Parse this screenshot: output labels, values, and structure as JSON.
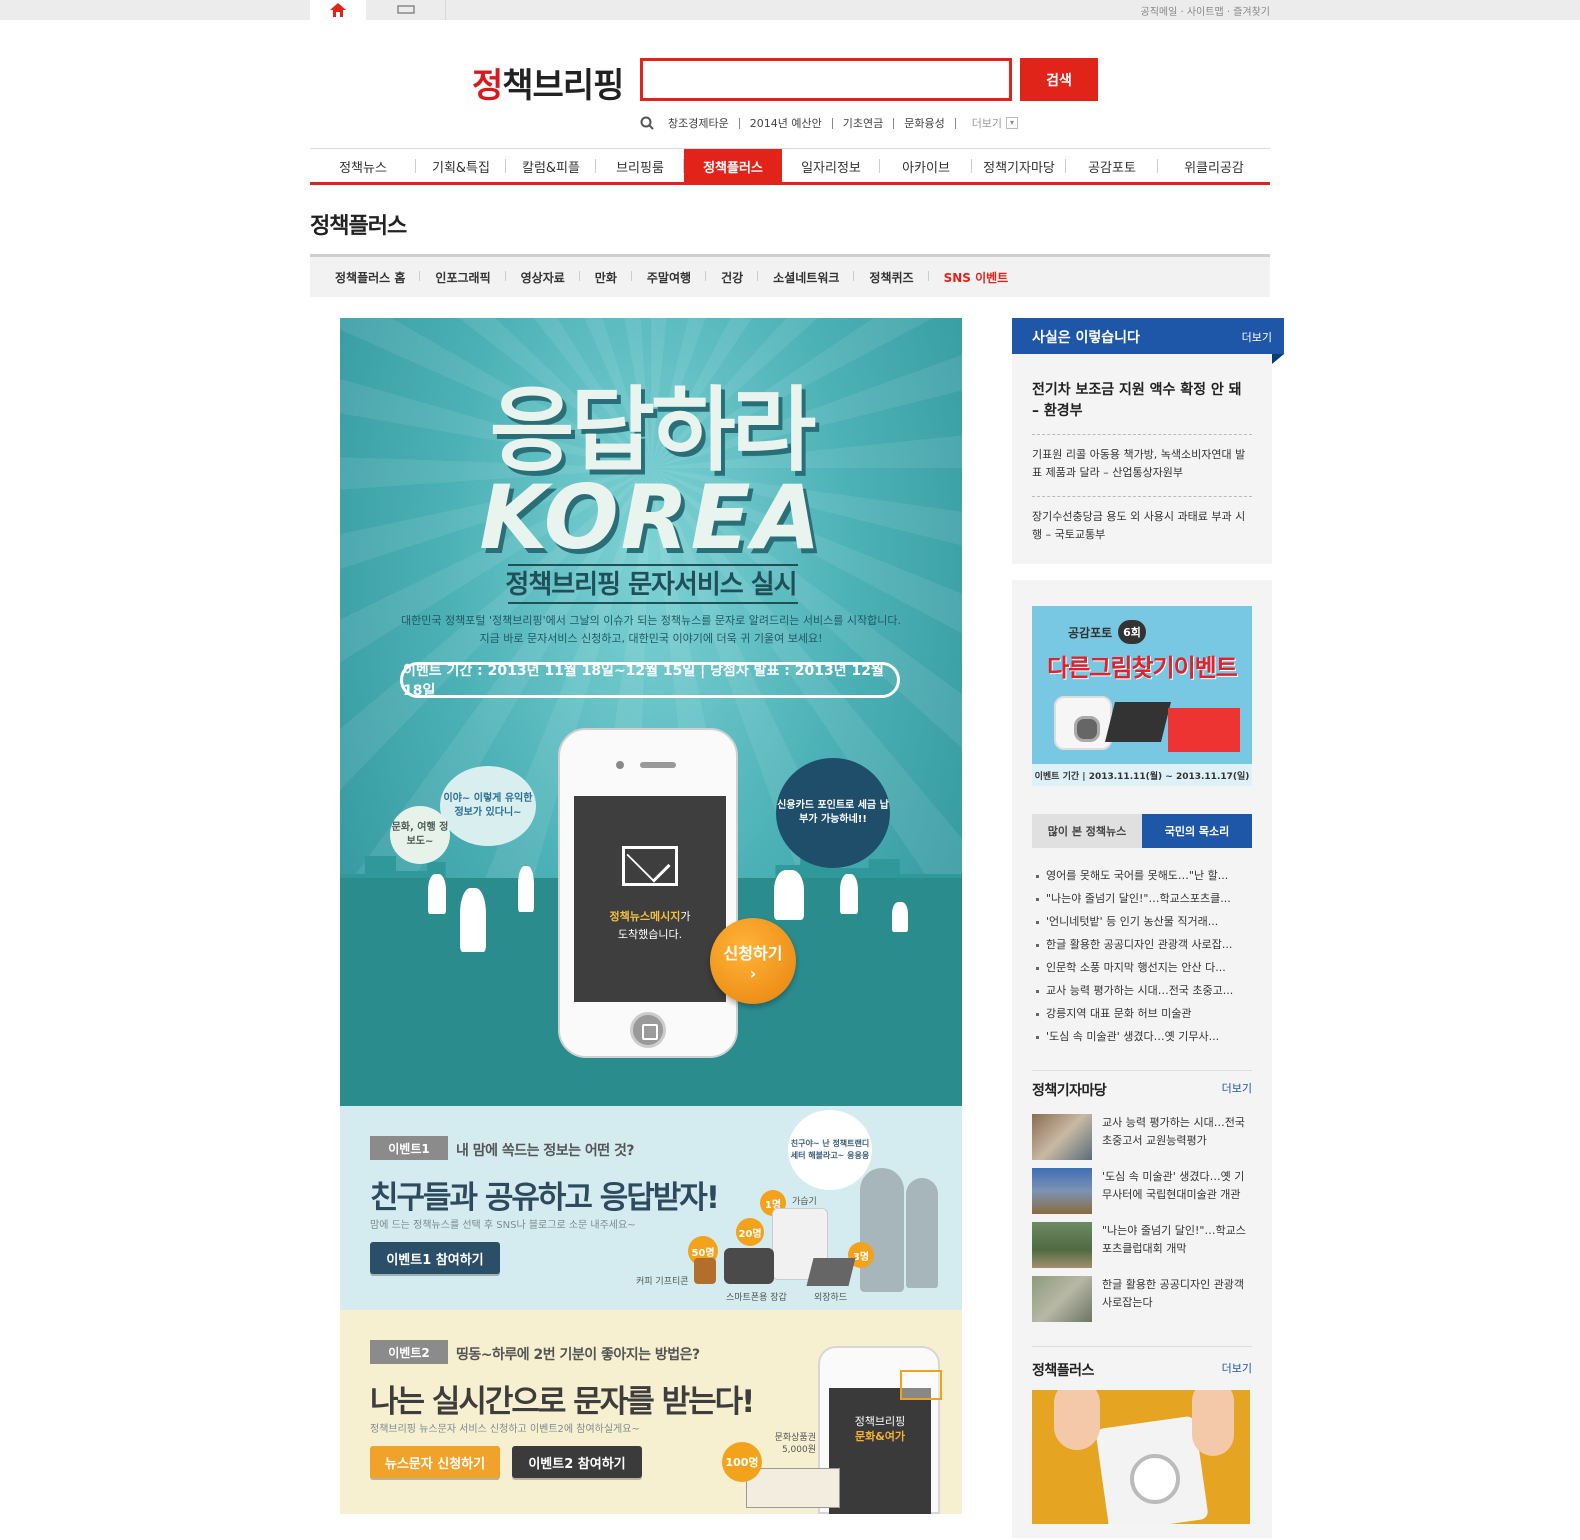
{
  "topbar": {
    "links": "공직메일 · 사이트맵 · 즐겨찾기"
  },
  "header": {
    "logo": "정책브리핑",
    "search_placeholder": "",
    "search_button": "검색",
    "keywords": [
      "창조경제타운",
      "2014년 예산안",
      "기초연금",
      "문화융성"
    ],
    "more": "더보기"
  },
  "gnb": [
    "정책뉴스",
    "기획&특집",
    "칼럼&피플",
    "브리핑룸",
    "정책플러스",
    "일자리정보",
    "아카이브",
    "정책기자마당",
    "공감포토",
    "위클리공감"
  ],
  "gnb_active": 4,
  "page_title": "정책플러스",
  "subnav": [
    "정책플러스 홈",
    "인포그래픽",
    "영상자료",
    "만화",
    "주말여행",
    "건강",
    "소셜네트워크",
    "정책퀴즈",
    "SNS 이벤트"
  ],
  "banner": {
    "title1": "응답하라",
    "title2": "KOREA",
    "subtitle": "정책브리핑 문자서비스 실시",
    "desc1": "대한민국 정책포털 '정책브리핑'에서 그날의 이슈가 되는 정책뉴스를 문자로 알려드리는 서비스를 시작합니다.",
    "desc2": "지금 바로 문자서비스 신청하고, 대한민국 이야기에 더욱 귀 기울여 보세요!",
    "period": "이벤트 기간 : 2013년 11월 18일~12월 15일 | 당첨자 발표 : 2013년 12월 18일",
    "bubble1": "이야~ 이렇게 유익한 정보가 있다니~",
    "bubble2": "문화, 여행 정보도~",
    "bubble3": "신용카드 포인트로 세금 납부가 가능하네!!",
    "phone_msg_highlight": "정책뉴스메시지",
    "phone_msg_rest1": "가",
    "phone_msg_rest2": "도착했습니다.",
    "apply": "신청하기",
    "apply_arrow": "›",
    "ev1": {
      "tag": "이벤트1",
      "question": "내 맘에 쏙드는 정보는 어떤 것?",
      "headline": "친구들과 공유하고 응답받자!",
      "desc": "맘에 드는 정책뉴스를 선택 후 SNS나 블로그로 소문 내주세요~",
      "button": "이벤트1 참여하기",
      "bubble": "친구야~ 난 정책트랜디세터 해볼라고~ 응응응",
      "prizes": [
        {
          "count": "1명",
          "label": "가습기"
        },
        {
          "count": "20명",
          "label": "스마트폰용 장갑"
        },
        {
          "count": "50명",
          "label": "커피 기프티콘"
        },
        {
          "count": "3명",
          "label": "외장하드"
        }
      ]
    },
    "ev2": {
      "tag": "이벤트2",
      "question": "띵동~하루에 2번 기분이 좋아지는 방법은?",
      "headline": "나는 실시간으로 문자를 받는다!",
      "desc": "정책브리핑 뉴스문자 서비스 신청하고 이벤트2에 참여하실게요~",
      "button_apply": "뉴스문자 신청하기",
      "button_join": "이벤트2 참여하기",
      "prize_count": "100명",
      "prize_label": "문화상품권 5,000원",
      "phone_title": "정책브리핑",
      "phone_sub": "문화&여가"
    }
  },
  "sidebar": {
    "fact": {
      "title": "사실은 이렇습니다",
      "more": "더보기",
      "main": "전기차 보조금 지원 액수 확정 안 돼 – 환경부",
      "items": [
        "기표원 리콜 아동용 책가방, 녹색소비자연대 발표 제품과 달라 – 산업통상자원부",
        "장기수선충당금 용도 외 사용시 과태료 부과 시행 – 국토교통부"
      ]
    },
    "photo_ad": {
      "label": "공감포토",
      "round": "6회",
      "title": "다른그림찾기이벤트",
      "period": "이벤트 기간 | 2013.11.11(월) ~ 2013.11.17(일)"
    },
    "tabs": [
      "많이 본 정책뉴스",
      "국민의 목소리"
    ],
    "tab_active": 1,
    "news": [
      "영어를 못해도 국어를 못해도…\"난 할...",
      "\"나는야 줄넘기 달인!\"…학교스포츠클...",
      "'언니네텃밭' 등 인기 농산물 직거래...",
      "한글 활용한 공공디자인 관광객 사로잡...",
      "인문학 소풍 마지막 행선지는 안산 다...",
      "교사 능력 평가하는 시대…전국 초중고...",
      "강릉지역 대표 문화 허브 미술관",
      "'도심 속 미술관' 생겼다…옛 기무사..."
    ],
    "reporter": {
      "title": "정책기자마당",
      "more": "더보기",
      "items": [
        "교사 능력 평가하는 시대…전국 초중고서 교원능력평가",
        "'도심 속 미술관' 생겼다…옛 기무사터에 국립현대미술관 개관",
        "\"나는야 줄넘기 달인!\"…학교스포츠클럽대회 개막",
        "한글 활용한 공공디자인 관광객 사로잡는다"
      ]
    },
    "plus": {
      "title": "정책플러스",
      "more": "더보기"
    }
  }
}
